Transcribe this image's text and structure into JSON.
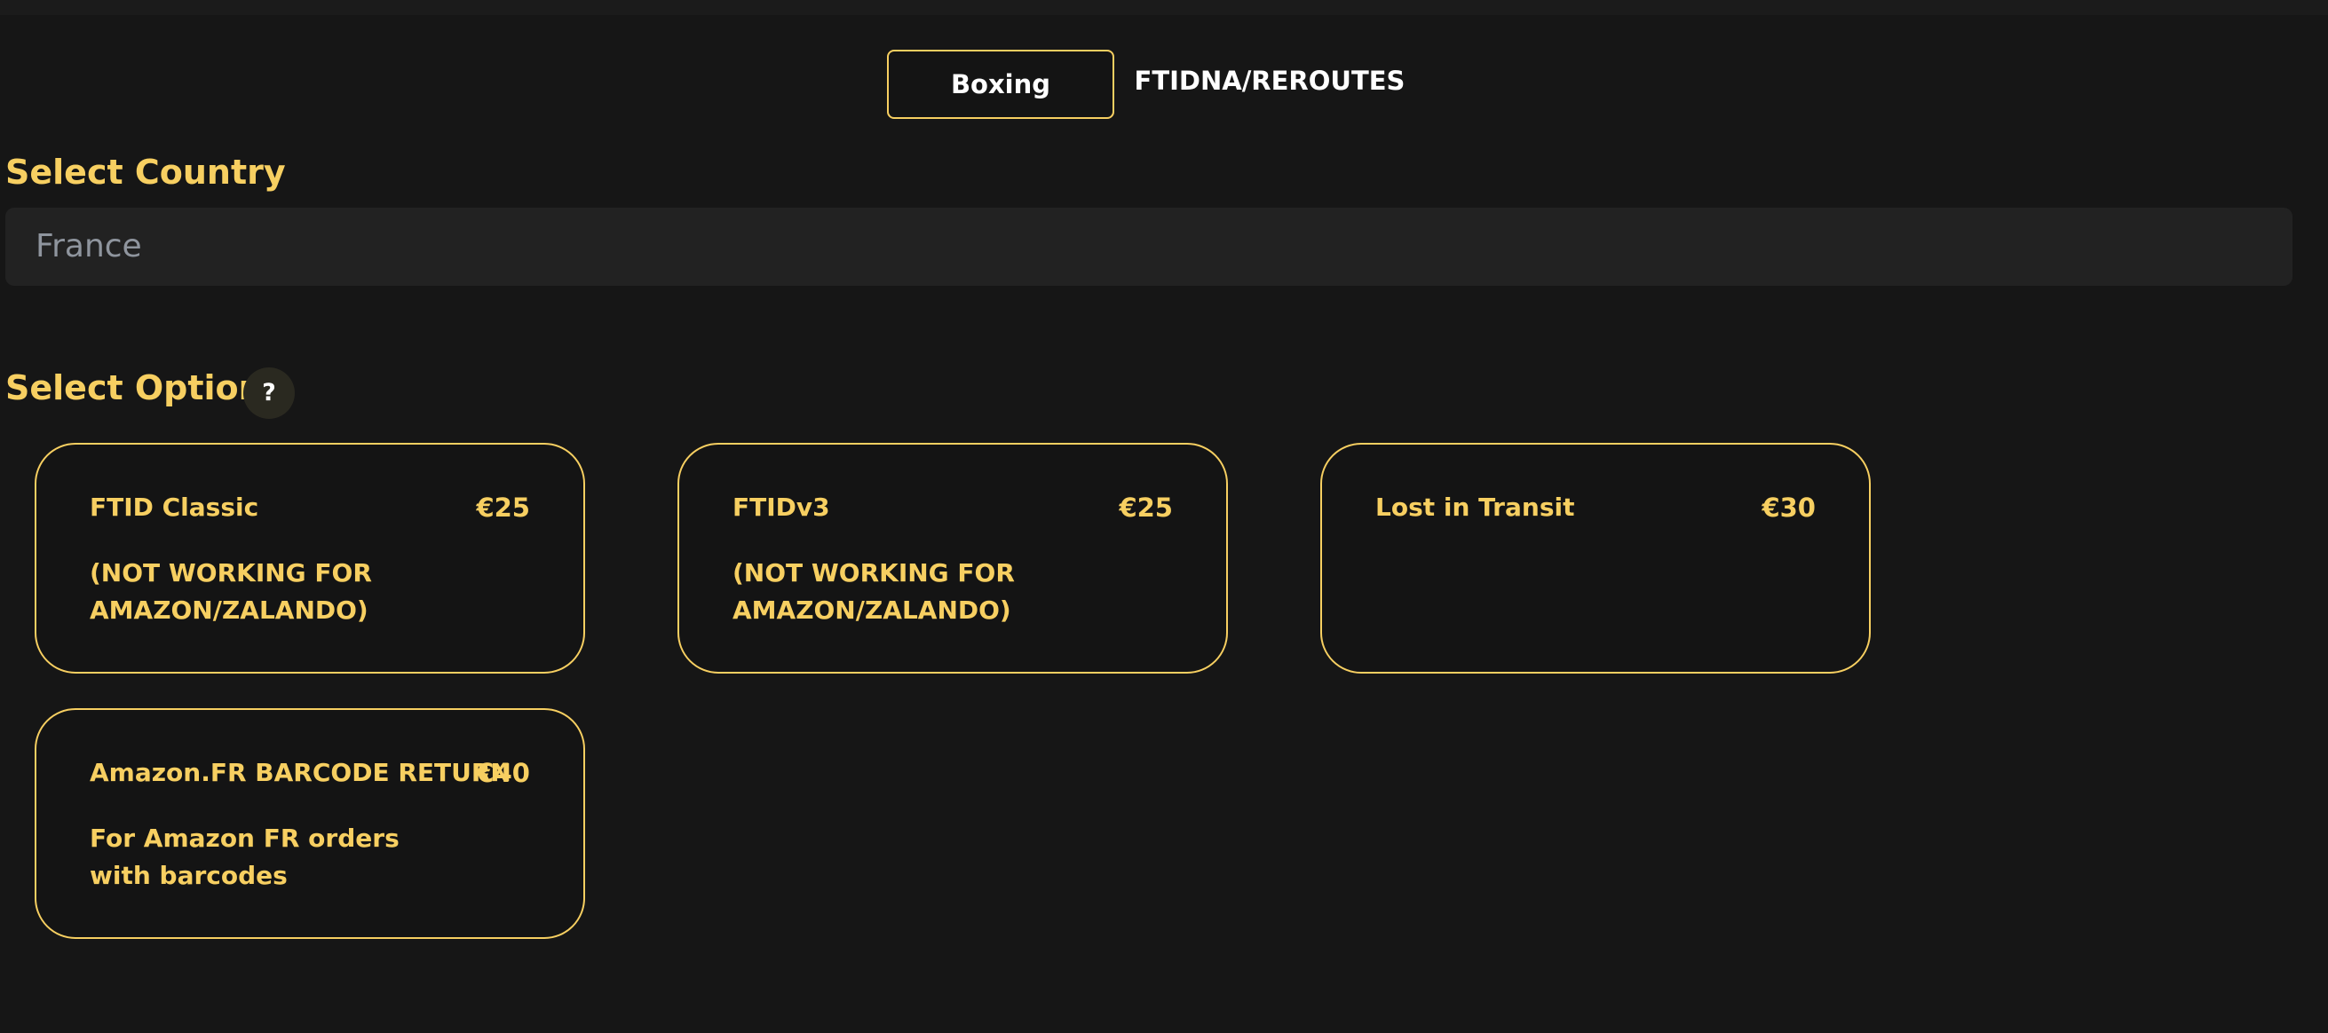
{
  "tabs": {
    "boxing": "Boxing",
    "ftidna": "FTIDNA/REROUTES"
  },
  "country": {
    "heading": "Select Country",
    "selected": "France"
  },
  "options": {
    "heading": "Select Option",
    "help_icon": "?",
    "items": [
      {
        "name": "FTID Classic",
        "price": "€25",
        "description": "(NOT WORKING FOR AMAZON/ZALANDO)"
      },
      {
        "name": "FTIDv3",
        "price": "€25",
        "description": "(NOT WORKING FOR AMAZON/ZALANDO)"
      },
      {
        "name": "Lost in Transit",
        "price": "€30",
        "description": ""
      },
      {
        "name": "Amazon.FR BARCODE RETURN",
        "price": "€40",
        "description": "For Amazon FR orders with barcodes"
      }
    ]
  },
  "colors": {
    "accent": "#f7cf61",
    "background": "#161616",
    "input_background": "#222222",
    "placeholder_text": "#8f959e"
  }
}
